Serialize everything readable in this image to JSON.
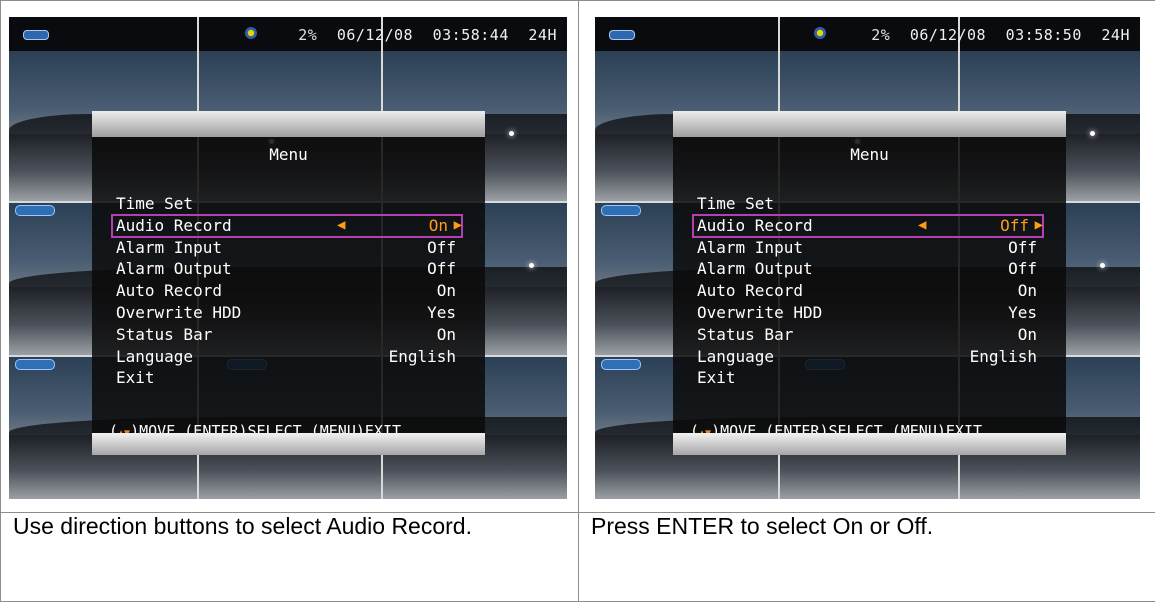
{
  "screens": [
    {
      "status": {
        "percent": "2%",
        "date": "06/12/08",
        "time": "03:58:44",
        "mode": "24H"
      },
      "menu": {
        "title": "Menu",
        "items": [
          {
            "label": "Time Set",
            "value": ""
          },
          {
            "label": "Audio Record",
            "value": "On"
          },
          {
            "label": "Alarm Input",
            "value": "Off"
          },
          {
            "label": "Alarm Output",
            "value": "Off"
          },
          {
            "label": "Auto Record",
            "value": "On"
          },
          {
            "label": "Overwrite HDD",
            "value": "Yes"
          },
          {
            "label": "Status Bar",
            "value": "On"
          },
          {
            "label": "Language",
            "value": "English"
          },
          {
            "label": "Exit",
            "value": ""
          }
        ],
        "help": {
          "move": ")MOVE",
          "select": "(ENTER)SELECT",
          "exit": "(MENU)EXIT"
        }
      },
      "caption": "Use direction buttons to select Audio Record."
    },
    {
      "status": {
        "percent": "2%",
        "date": "06/12/08",
        "time": "03:58:50",
        "mode": "24H"
      },
      "menu": {
        "title": "Menu",
        "items": [
          {
            "label": "Time Set",
            "value": ""
          },
          {
            "label": "Audio Record",
            "value": "Off"
          },
          {
            "label": "Alarm Input",
            "value": "Off"
          },
          {
            "label": "Alarm Output",
            "value": "Off"
          },
          {
            "label": "Auto Record",
            "value": "On"
          },
          {
            "label": "Overwrite HDD",
            "value": "Yes"
          },
          {
            "label": "Status Bar",
            "value": "On"
          },
          {
            "label": "Language",
            "value": "English"
          },
          {
            "label": "Exit",
            "value": ""
          }
        ],
        "help": {
          "move": ")MOVE",
          "select": "(ENTER)SELECT",
          "exit": "(MENU)EXIT"
        }
      },
      "caption": "Press ENTER to select On or Off."
    }
  ],
  "colors": {
    "selection_outline": "#b53fb0",
    "arrow": "#ff9c1a",
    "menu_background": "#0a0a0a",
    "table_border": "#8c8c8c"
  },
  "icons": [
    "record-indicator-icon",
    "hdd-status-icon",
    "left-arrow-icon",
    "right-arrow-icon",
    "up-down-arrow-icon"
  ]
}
